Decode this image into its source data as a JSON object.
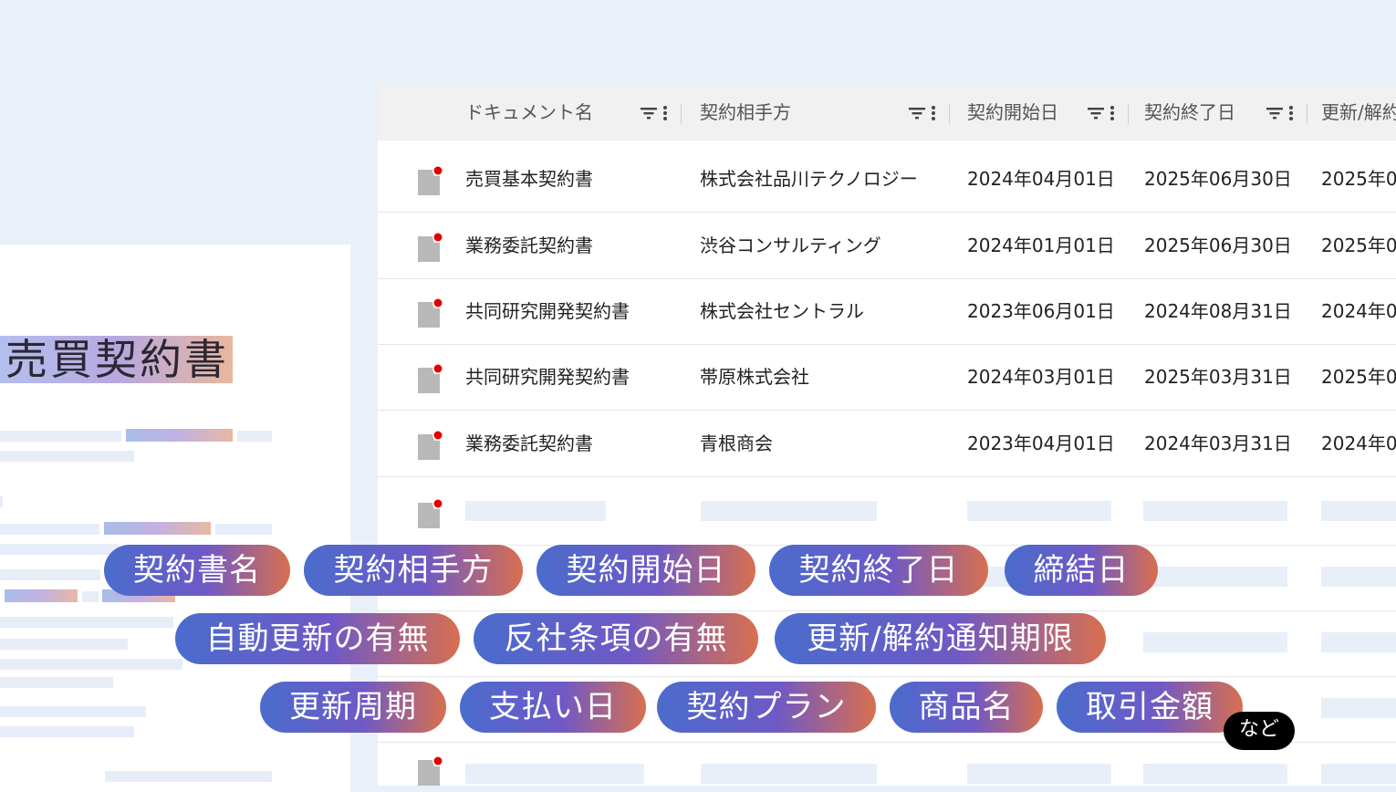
{
  "document_preview": {
    "title": "売買契約書"
  },
  "table": {
    "columns": [
      {
        "label": "ドキュメント名"
      },
      {
        "label": "契約相手方"
      },
      {
        "label": "契約開始日"
      },
      {
        "label": "契約終了日"
      },
      {
        "label": "更新/解約"
      }
    ],
    "rows": [
      {
        "name": "売買基本契約書",
        "party": "株式会社品川テクノロジー",
        "start": "2024年04月01日",
        "end": "2025年06月30日",
        "notice": "2025年0"
      },
      {
        "name": "業務委託契約書",
        "party": "渋谷コンサルティング",
        "start": "2024年01月01日",
        "end": "2025年06月30日",
        "notice": "2025年0"
      },
      {
        "name": "共同研究開発契約書",
        "party": "株式会社セントラル",
        "start": "2023年06月01日",
        "end": "2024年08月31日",
        "notice": "2024年0"
      },
      {
        "name": "共同研究開発契約書",
        "party": "帯原株式会社",
        "start": "2024年03月01日",
        "end": "2025年03月31日",
        "notice": "2025年0"
      },
      {
        "name": "業務委託契約書",
        "party": "青根商会",
        "start": "2023年04月01日",
        "end": "2024年03月31日",
        "notice": "2024年0"
      }
    ]
  },
  "tags": [
    "契約書名",
    "契約相手方",
    "契約開始日",
    "契約終了日",
    "締結日",
    "自動更新の有無",
    "反社条項の有無",
    "更新/解約通知期限",
    "更新周期",
    "支払い日",
    "契約プラン",
    "商品名",
    "取引金額"
  ],
  "more_label": "など",
  "colors": {
    "background": "#e9f0fa",
    "header_bg": "#f1f1f1",
    "chip_gradient_start": "#4a6ccc",
    "chip_gradient_mid": "#6f59c6",
    "chip_gradient_end": "#d86f4f",
    "notification_dot": "#e00000",
    "doc_icon": "#b8b8b8"
  }
}
